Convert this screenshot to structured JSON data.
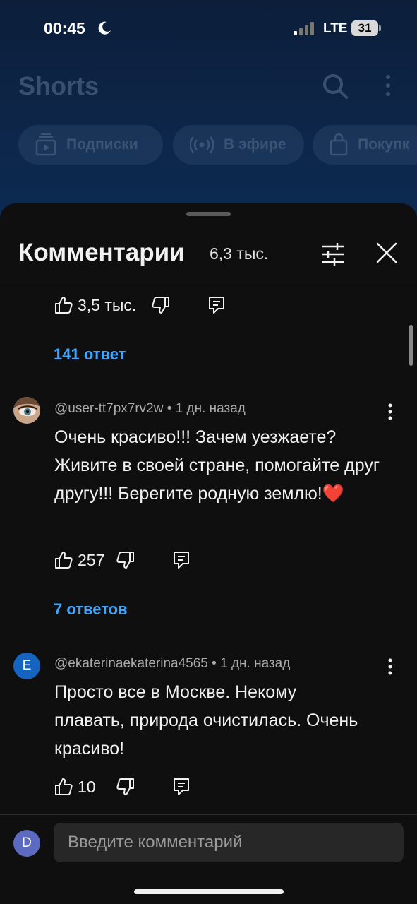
{
  "status_bar": {
    "time": "00:45",
    "network": "LTE",
    "battery": "31"
  },
  "background": {
    "title": "Shorts",
    "chips": [
      {
        "label": "Подписки",
        "icon": "subscriptions-icon"
      },
      {
        "label": "В эфире",
        "icon": "live-icon"
      },
      {
        "label": "Покупк",
        "icon": "shopping-bag-icon"
      }
    ]
  },
  "sheet": {
    "title": "Комментарии",
    "count": "6,3 тыс.",
    "icons": {
      "filter": "filter-icon",
      "close": "close-icon"
    }
  },
  "top_actions": {
    "likes": "3,5 тыс.",
    "replies_link": "141 ответ"
  },
  "comments": [
    {
      "author": "@user-tt7px7rv2w",
      "time": "1 дн. назад",
      "text": "Очень красиво!!! Зачем уезжаете? Живите в своей стране, помогайте друг другу!!! Берегите родную землю!",
      "emoji": "❤️",
      "likes": "257",
      "replies_link": "7 ответов"
    },
    {
      "author": "@ekaterinaekaterina4565",
      "avatar_letter": "E",
      "time": "1 дн. назад",
      "text": "Просто все в Москве. Некому плавать, природа очистилась. Очень красиво!",
      "likes": "10"
    }
  ],
  "input": {
    "avatar_letter": "D",
    "placeholder": "Введите комментарий"
  },
  "colors": {
    "link": "#3ea6ff",
    "sheet_bg": "#0f0f0f",
    "input_bg": "#272727"
  }
}
